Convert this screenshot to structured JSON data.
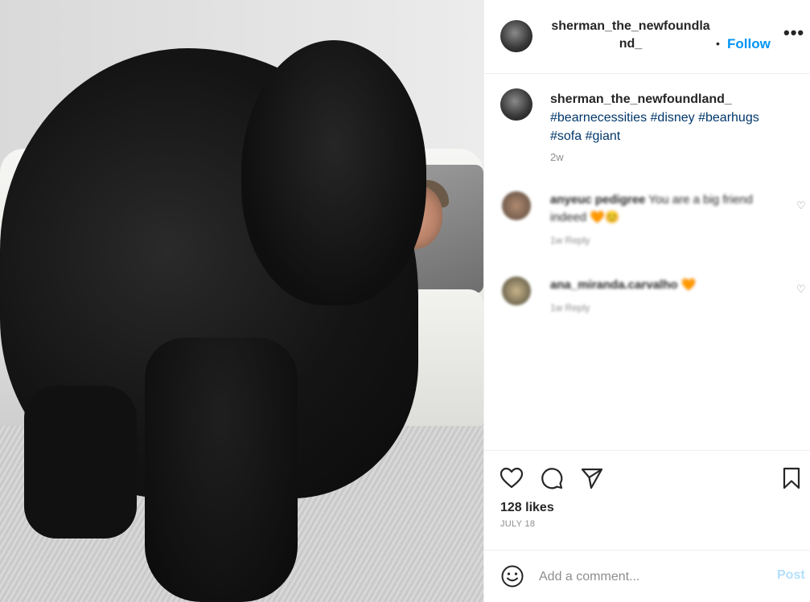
{
  "post": {
    "username_header": "sherman_the_newfoundland_",
    "follow_label": "Follow",
    "more_label": "•••",
    "caption": {
      "username": "sherman_the_newfoundland_",
      "hashtags": "#bearnecessities #disney #bearhugs #sofa #giant",
      "time": "2w"
    },
    "comments": [
      {
        "username": "anyeuc pedigree",
        "text": "You are a big friend indeed 🧡😊",
        "meta": "1w  Reply"
      },
      {
        "username": "ana_miranda.carvalho",
        "text": "🧡",
        "meta": "1w  Reply"
      }
    ],
    "likes": "128 likes",
    "date": "JULY 18",
    "add_comment_placeholder": "Add a comment...",
    "post_label": "Post"
  },
  "icons": {
    "like": "heart-icon",
    "comment": "comment-icon",
    "share": "paper-plane-icon",
    "save": "bookmark-icon",
    "emoji": "smiley-icon"
  },
  "colors": {
    "link_blue": "#0095f6",
    "hashtag_blue": "#00376b",
    "muted": "#8e8e8e",
    "post_disabled": "#b2dffc"
  }
}
